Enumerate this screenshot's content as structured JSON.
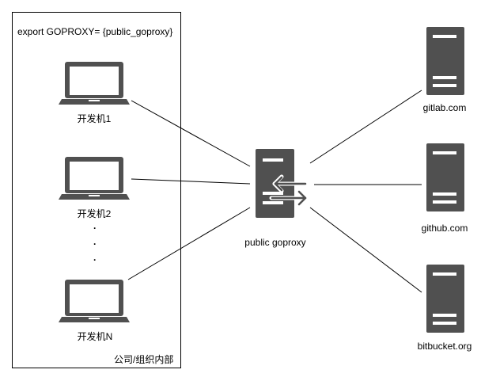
{
  "org_box": {
    "env_label": "export GOPROXY= {public_goproxy}",
    "caption": "公司/组织内部"
  },
  "dev_machines": [
    {
      "label": "开发机1",
      "icon": "laptop-icon"
    },
    {
      "label": "开发机2",
      "icon": "laptop-icon"
    },
    {
      "label": "开发机N",
      "icon": "laptop-icon"
    }
  ],
  "ellipsis": "·\n·\n·",
  "proxy": {
    "label": "public goproxy",
    "icon": "proxy-server-icon"
  },
  "upstreams": [
    {
      "label": "gitlab.com",
      "icon": "server-icon"
    },
    {
      "label": "github.com",
      "icon": "server-icon"
    },
    {
      "label": "bitbucket.org",
      "icon": "server-icon"
    }
  ],
  "colors": {
    "icon_fill": "#505050",
    "line": "#000000"
  }
}
